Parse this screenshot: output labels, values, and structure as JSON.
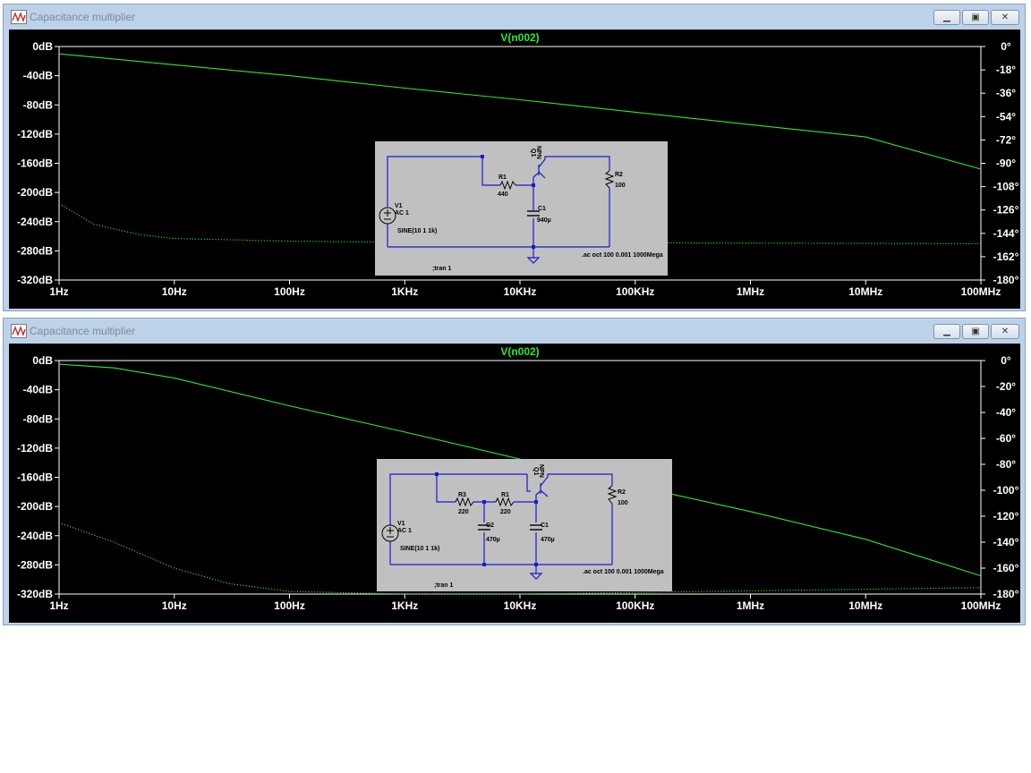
{
  "window1": {
    "title": "Capacitance multiplier",
    "trace_label": "V(n002)",
    "x_axis_labels": [
      "1Hz",
      "10Hz",
      "100Hz",
      "1KHz",
      "10KHz",
      "100KHz",
      "1MHz",
      "10MHz",
      "100MHz"
    ],
    "y_left_labels": [
      "0dB",
      "-40dB",
      "-80dB",
      "-120dB",
      "-160dB",
      "-200dB",
      "-240dB",
      "-280dB",
      "-320dB"
    ],
    "y_right_labels": [
      "0°",
      "-18°",
      "-36°",
      "-54°",
      "-72°",
      "-90°",
      "-108°",
      "-126°",
      "-144°",
      "-162°",
      "-180°"
    ],
    "schematic": {
      "v1_name": "V1",
      "v1_value": "AC 1",
      "v1_func": "SINE(10 1 1k)",
      "r1_name": "R1",
      "r1_value": "440",
      "c1_name": "C1",
      "c1_value": "940µ",
      "q1_name": "Q1",
      "q1_type": "NPN",
      "r2_name": "R2",
      "r2_value": "100",
      "ac_directive": ".ac oct 100 0.001 1000Mega",
      "tran_directive": ";tran 1"
    }
  },
  "window2": {
    "title": "Capacitance multiplier",
    "trace_label": "V(n002)",
    "x_axis_labels": [
      "1Hz",
      "10Hz",
      "100Hz",
      "1KHz",
      "10KHz",
      "100KHz",
      "1MHz",
      "10MHz",
      "100MHz"
    ],
    "y_left_labels": [
      "0dB",
      "-40dB",
      "-80dB",
      "-120dB",
      "-160dB",
      "-200dB",
      "-240dB",
      "-280dB",
      "-320dB"
    ],
    "y_right_labels": [
      "0°",
      "-20°",
      "-40°",
      "-60°",
      "-80°",
      "-100°",
      "-120°",
      "-140°",
      "-160°",
      "-180°"
    ],
    "schematic": {
      "v1_name": "V1",
      "v1_value": "AC 1",
      "v1_func": "SINE(10 1 1k)",
      "r3_name": "R3",
      "r3_value": "220",
      "r1_name": "R1",
      "r1_value": "220",
      "c2_name": "C2",
      "c2_value": "470µ",
      "c1_name": "C1",
      "c1_value": "470µ",
      "q1_name": "Q1",
      "q1_type": "NPN",
      "r2_name": "R2",
      "r2_value": "100",
      "ac_directive": ".ac oct 100 0.001 1000Mega",
      "tran_directive": ";tran 1"
    }
  },
  "colors": {
    "plot_bg": "#000000",
    "trace": "#2ee82e",
    "schematic_wire": "#1a1acc",
    "schematic_bg": "#c0c0c0"
  },
  "chart_data": [
    {
      "type": "line",
      "x_scale": "log",
      "x_range_hz": [
        1,
        100000000
      ],
      "ylim_db": [
        -320,
        0
      ],
      "ylim_deg": [
        -180,
        0
      ],
      "series": [
        {
          "name": "V(n002)",
          "style": "solid",
          "x_hz": [
            1,
            10,
            100,
            1000,
            10000,
            100000,
            1000000,
            10000000,
            100000000
          ],
          "y_db": [
            -10,
            -25,
            -40,
            -57,
            -73,
            -90,
            -107,
            -124,
            -168
          ]
        },
        {
          "style": "dotted",
          "x_hz": [
            1,
            2,
            5,
            10,
            100,
            1000,
            10000,
            100000000
          ],
          "y_deg": [
            -121,
            -137,
            -145,
            -148,
            -150,
            -151,
            -151,
            -152
          ]
        }
      ]
    },
    {
      "type": "line",
      "x_scale": "log",
      "x_range_hz": [
        1,
        100000000
      ],
      "ylim_db": [
        -320,
        0
      ],
      "ylim_deg": [
        -180,
        0
      ],
      "series": [
        {
          "name": "V(n002)",
          "style": "solid",
          "x_hz": [
            1,
            3,
            10,
            100,
            1000,
            10000,
            100000,
            1000000,
            10000000,
            100000000
          ],
          "y_db": [
            -5,
            -10,
            -24,
            -62,
            -98,
            -135,
            -172,
            -207,
            -245,
            -295
          ]
        },
        {
          "style": "dotted",
          "x_hz": [
            1,
            3,
            10,
            30,
            100,
            1000,
            10000,
            100000000
          ],
          "y_deg": [
            -125,
            -140,
            -160,
            -172,
            -178,
            -180,
            -180,
            -175
          ]
        }
      ]
    }
  ]
}
